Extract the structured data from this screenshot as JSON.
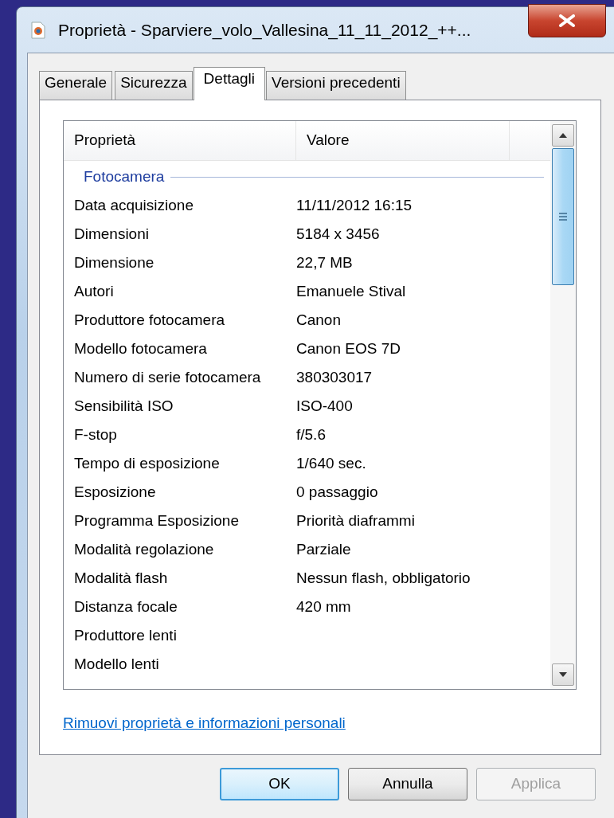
{
  "window": {
    "title": "Proprietà - Sparviere_volo_Vallesina_11_11_2012_++..."
  },
  "tabs": [
    {
      "label": "Generale",
      "selected": false
    },
    {
      "label": "Sicurezza",
      "selected": false
    },
    {
      "label": "Dettagli",
      "selected": true
    },
    {
      "label": "Versioni precedenti",
      "selected": false
    }
  ],
  "details": {
    "columns": [
      "Proprietà",
      "Valore"
    ],
    "group": "Fotocamera",
    "rows": [
      {
        "name": "Data acquisizione",
        "value": "11/11/2012 16:15"
      },
      {
        "name": "Dimensioni",
        "value": "5184 x 3456"
      },
      {
        "name": "Dimensione",
        "value": "22,7 MB"
      },
      {
        "name": "Autori",
        "value": "Emanuele Stival"
      },
      {
        "name": "Produttore fotocamera",
        "value": "Canon"
      },
      {
        "name": "Modello fotocamera",
        "value": "Canon EOS 7D"
      },
      {
        "name": "Numero di serie fotocamera",
        "value": "380303017"
      },
      {
        "name": "Sensibilità ISO",
        "value": "ISO-400"
      },
      {
        "name": "F-stop",
        "value": "f/5.6"
      },
      {
        "name": "Tempo di esposizione",
        "value": "1/640 sec."
      },
      {
        "name": "Esposizione",
        "value": "0 passaggio"
      },
      {
        "name": "Programma Esposizione",
        "value": "Priorità diaframmi"
      },
      {
        "name": "Modalità regolazione",
        "value": "Parziale"
      },
      {
        "name": "Modalità flash",
        "value": "Nessun flash, obbligatorio"
      },
      {
        "name": "Distanza focale",
        "value": "420 mm"
      },
      {
        "name": "Produttore lenti"
      },
      {
        "name": "Modello lenti"
      }
    ]
  },
  "link": "Rimuovi proprietà e informazioni personali",
  "buttons": [
    {
      "label": "OK",
      "default": true,
      "disabled": false
    },
    {
      "label": "Annulla",
      "default": false,
      "disabled": false
    },
    {
      "label": "Applica",
      "default": false,
      "disabled": true
    }
  ]
}
